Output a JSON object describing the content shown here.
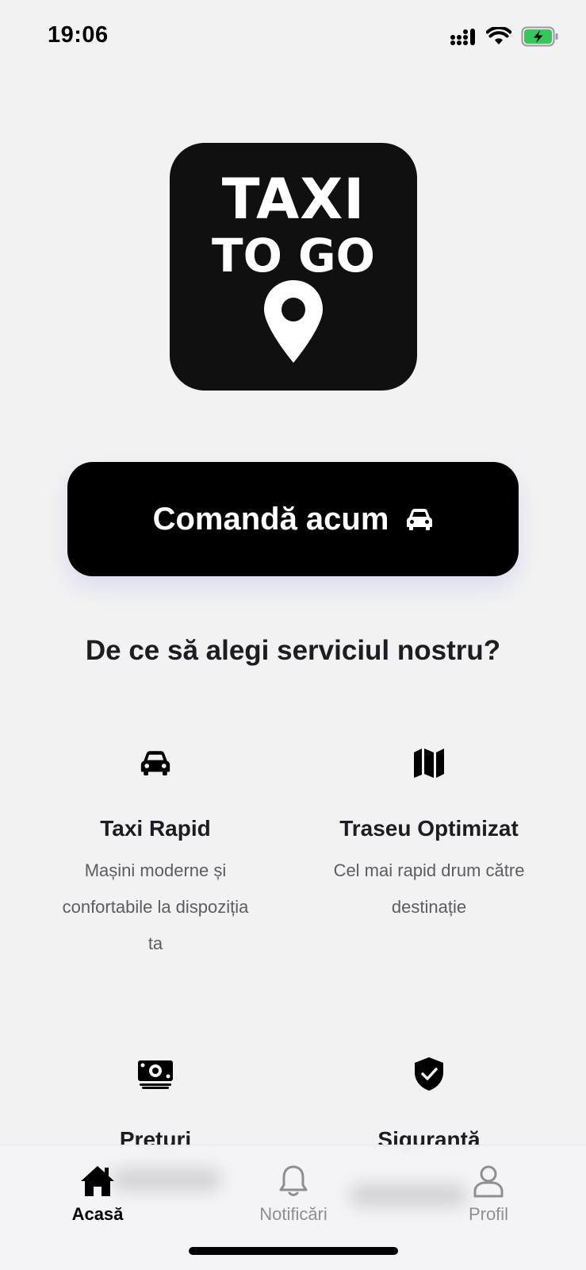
{
  "status_bar": {
    "time": "19:06",
    "battery_color": "#34c759"
  },
  "logo": {
    "line1": "TAXI",
    "line2": "TO GO",
    "icon": "map-pin-icon"
  },
  "order_button": {
    "label": "Comandă acum",
    "icon": "car-icon"
  },
  "section_title": "De ce să alegi serviciul nostru?",
  "features": [
    {
      "icon": "car-icon",
      "title": "Taxi Rapid",
      "description": "Mașini moderne și confortabile la dispoziția ta"
    },
    {
      "icon": "map-icon",
      "title": "Traseu Optimizat",
      "description": "Cel mai rapid drum către destinație"
    },
    {
      "icon": "money-icon",
      "title": "Prețuri",
      "description": ""
    },
    {
      "icon": "shield-check-icon",
      "title": "Siguranță",
      "description": ""
    }
  ],
  "tab_bar": {
    "tabs": [
      {
        "label": "Acasă",
        "icon": "home-icon",
        "active": true
      },
      {
        "label": "Notificări",
        "icon": "bell-icon",
        "active": false
      },
      {
        "label": "Profil",
        "icon": "user-icon",
        "active": false
      }
    ]
  }
}
